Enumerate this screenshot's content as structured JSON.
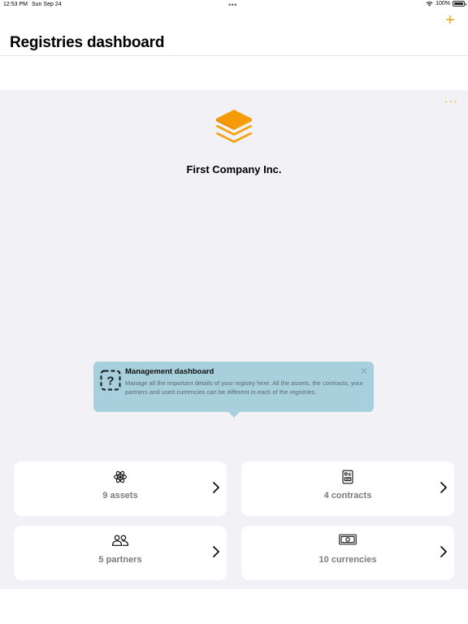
{
  "status_bar": {
    "time": "12:53 PM",
    "date": "Sun Sep 24",
    "battery": "100%"
  },
  "nav": {
    "title": "Registries dashboard",
    "add_label": "+"
  },
  "company": {
    "name": "First Company Inc.",
    "more_label": "···"
  },
  "tooltip": {
    "title": "Management dashboard",
    "body": "Manage all the important details of your registry here. All the assets, the contracts, your partners and used currencies can be different in each of the registries.",
    "close_label": "✕"
  },
  "cards": {
    "assets": {
      "label": "9 assets",
      "icon": "atom-icon"
    },
    "contracts": {
      "label": "4 contracts",
      "icon": "contract-icon"
    },
    "partners": {
      "label": "5 partners",
      "icon": "people-icon"
    },
    "currencies": {
      "label": "10 currencies",
      "icon": "banknote-icon"
    }
  },
  "colors": {
    "accent": "#f5a00a",
    "background": "#f2f2f6",
    "tooltip": "#a7cfdc",
    "card": "#ffffff"
  }
}
